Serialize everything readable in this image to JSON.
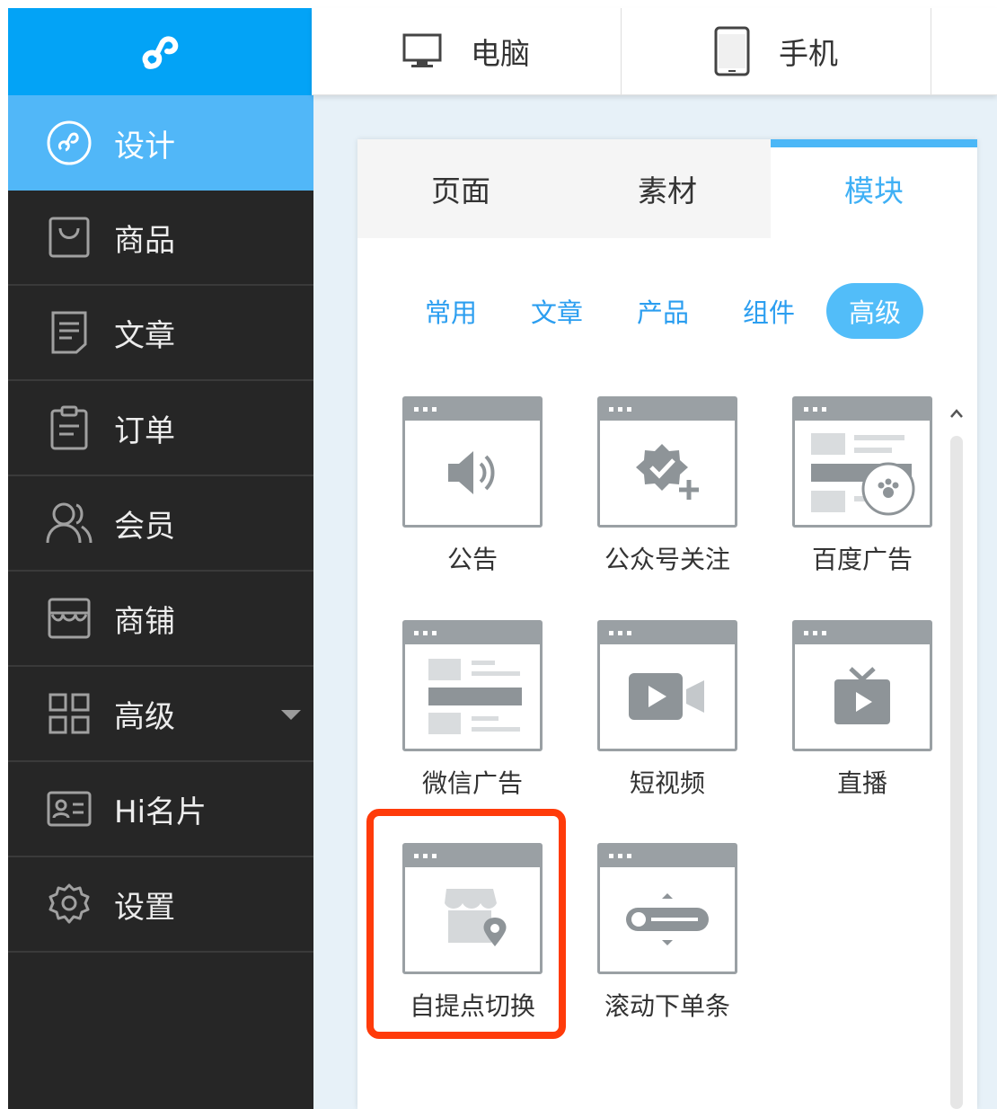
{
  "brand": {
    "logo_icon": "mini-program-logo-icon",
    "brand_color": "#03a3f6"
  },
  "devices": [
    {
      "label": "电脑",
      "icon": "desktop-monitor-icon"
    },
    {
      "label": "手机",
      "icon": "mobile-phone-icon"
    }
  ],
  "sidebar": {
    "items": [
      {
        "label": "设计",
        "icon": "design-logo-icon",
        "active": true
      },
      {
        "label": "商品",
        "icon": "shopping-bag-icon"
      },
      {
        "label": "文章",
        "icon": "document-icon"
      },
      {
        "label": "订单",
        "icon": "clipboard-icon"
      },
      {
        "label": "会员",
        "icon": "members-icon"
      },
      {
        "label": "商铺",
        "icon": "storefront-icon"
      },
      {
        "label": "高级",
        "icon": "grid-icon",
        "has_dropdown": true
      },
      {
        "label": "Hi名片",
        "icon": "id-card-icon"
      },
      {
        "label": "设置",
        "icon": "gear-icon"
      }
    ]
  },
  "panel": {
    "tabs": [
      "页面",
      "素材",
      "模块"
    ],
    "active_tab": "模块",
    "categories": [
      "常用",
      "文章",
      "产品",
      "组件",
      "高级"
    ],
    "active_category": "高级",
    "modules": [
      {
        "label": "公告",
        "icon": "speaker-icon"
      },
      {
        "label": "公众号关注",
        "icon": "verified-badge-plus-icon"
      },
      {
        "label": "百度广告",
        "icon": "baidu-ad-icon"
      },
      {
        "label": "微信广告",
        "icon": "wechat-ad-layout-icon"
      },
      {
        "label": "短视频",
        "icon": "video-camera-icon"
      },
      {
        "label": "直播",
        "icon": "live-tv-icon"
      },
      {
        "label": "自提点切换",
        "icon": "store-location-icon",
        "highlighted": true
      },
      {
        "label": "滚动下单条",
        "icon": "scroll-order-bar-icon"
      }
    ]
  },
  "colors": {
    "accent": "#4bb7f7",
    "sidebar_bg": "#262626",
    "highlight_outline": "#ff3b0a"
  }
}
